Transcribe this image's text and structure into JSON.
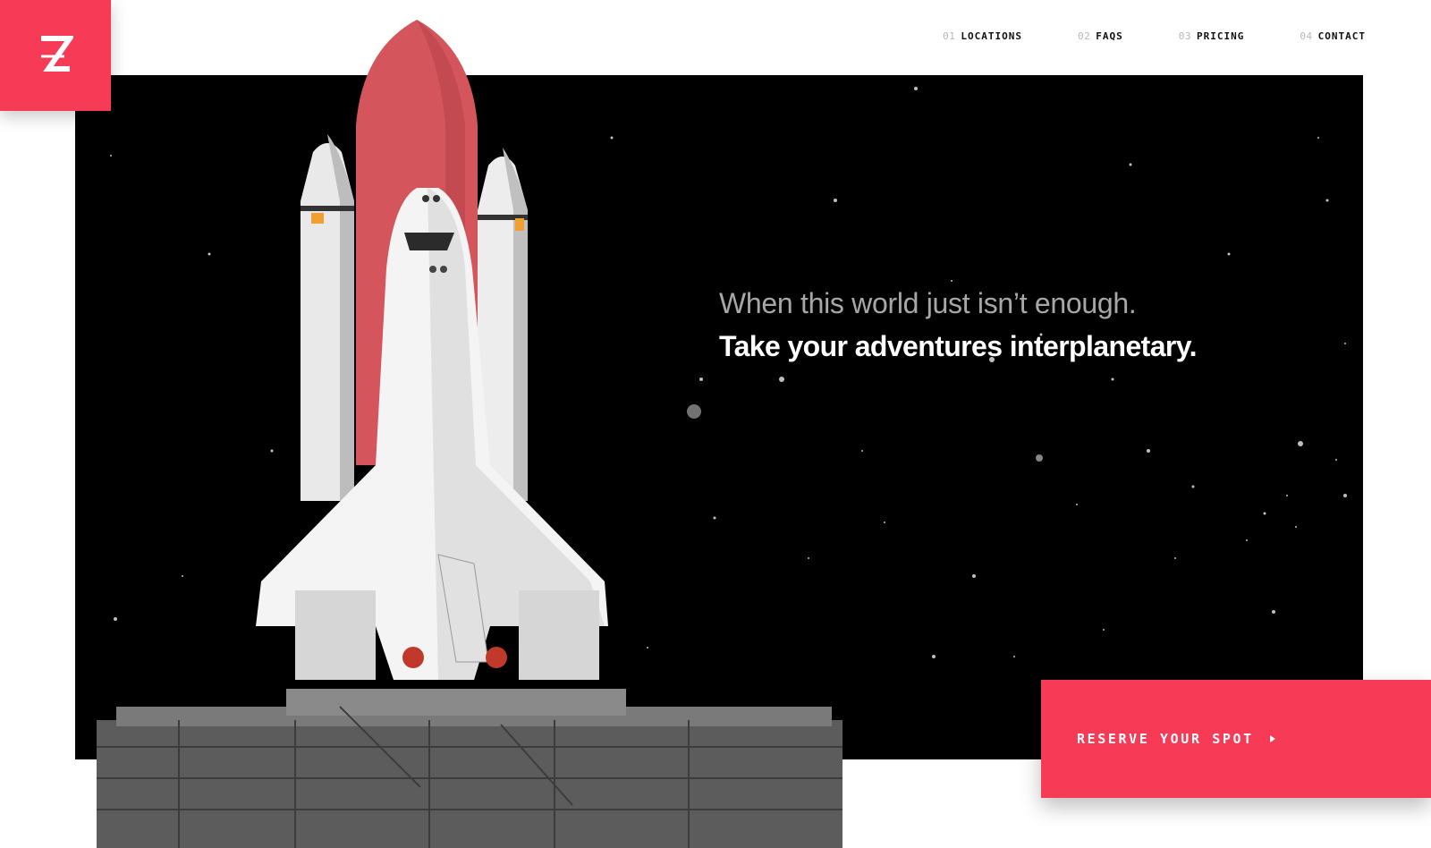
{
  "brand": {
    "logo_letter": "Z",
    "accent": "#f73a56"
  },
  "nav": {
    "items": [
      {
        "num": "01",
        "label": "LOCATIONS"
      },
      {
        "num": "02",
        "label": "FAQS"
      },
      {
        "num": "03",
        "label": "PRICING"
      },
      {
        "num": "04",
        "label": "CONTACT"
      }
    ]
  },
  "hero": {
    "line1": "When this world just isn’t enough.",
    "line2": "Take your adventures interplanetary.",
    "image": "space-shuttle-on-launch-pad"
  },
  "cta": {
    "label": "RESERVE YOUR SPOT",
    "icon": "play-arrow-icon"
  }
}
